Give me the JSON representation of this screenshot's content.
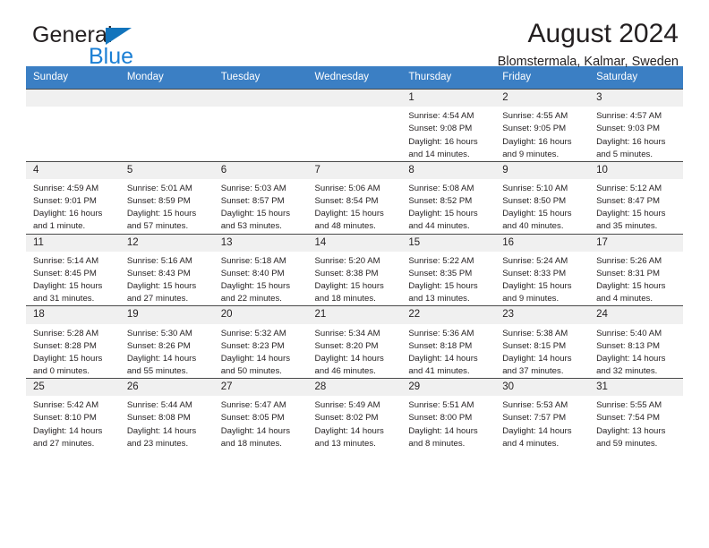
{
  "brand": {
    "name_top": "General",
    "name_bottom": "Blue",
    "triangle_color": "#1274bc",
    "blue_text_color": "#1b7fd4"
  },
  "header": {
    "title": "August 2024",
    "subtitle": "Blomstermala, Kalmar, Sweden",
    "header_bg_color": "#3b7fc4",
    "header_text_color": "#ffffff"
  },
  "calendar": {
    "weekday_headers": [
      "Sunday",
      "Monday",
      "Tuesday",
      "Wednesday",
      "Thursday",
      "Friday",
      "Saturday"
    ],
    "labels": {
      "sunrise": "Sunrise:",
      "sunset": "Sunset:",
      "daylight": "Daylight:"
    },
    "weeks": [
      [
        {
          "day": "",
          "empty": true
        },
        {
          "day": "",
          "empty": true
        },
        {
          "day": "",
          "empty": true
        },
        {
          "day": "",
          "empty": true
        },
        {
          "day": "1",
          "sunrise": "Sunrise: 4:54 AM",
          "sunset": "Sunset: 9:08 PM",
          "daylight_1": "Daylight: 16 hours",
          "daylight_2": "and 14 minutes."
        },
        {
          "day": "2",
          "sunrise": "Sunrise: 4:55 AM",
          "sunset": "Sunset: 9:05 PM",
          "daylight_1": "Daylight: 16 hours",
          "daylight_2": "and 9 minutes."
        },
        {
          "day": "3",
          "sunrise": "Sunrise: 4:57 AM",
          "sunset": "Sunset: 9:03 PM",
          "daylight_1": "Daylight: 16 hours",
          "daylight_2": "and 5 minutes."
        }
      ],
      [
        {
          "day": "4",
          "sunrise": "Sunrise: 4:59 AM",
          "sunset": "Sunset: 9:01 PM",
          "daylight_1": "Daylight: 16 hours",
          "daylight_2": "and 1 minute."
        },
        {
          "day": "5",
          "sunrise": "Sunrise: 5:01 AM",
          "sunset": "Sunset: 8:59 PM",
          "daylight_1": "Daylight: 15 hours",
          "daylight_2": "and 57 minutes."
        },
        {
          "day": "6",
          "sunrise": "Sunrise: 5:03 AM",
          "sunset": "Sunset: 8:57 PM",
          "daylight_1": "Daylight: 15 hours",
          "daylight_2": "and 53 minutes."
        },
        {
          "day": "7",
          "sunrise": "Sunrise: 5:06 AM",
          "sunset": "Sunset: 8:54 PM",
          "daylight_1": "Daylight: 15 hours",
          "daylight_2": "and 48 minutes."
        },
        {
          "day": "8",
          "sunrise": "Sunrise: 5:08 AM",
          "sunset": "Sunset: 8:52 PM",
          "daylight_1": "Daylight: 15 hours",
          "daylight_2": "and 44 minutes."
        },
        {
          "day": "9",
          "sunrise": "Sunrise: 5:10 AM",
          "sunset": "Sunset: 8:50 PM",
          "daylight_1": "Daylight: 15 hours",
          "daylight_2": "and 40 minutes."
        },
        {
          "day": "10",
          "sunrise": "Sunrise: 5:12 AM",
          "sunset": "Sunset: 8:47 PM",
          "daylight_1": "Daylight: 15 hours",
          "daylight_2": "and 35 minutes."
        }
      ],
      [
        {
          "day": "11",
          "sunrise": "Sunrise: 5:14 AM",
          "sunset": "Sunset: 8:45 PM",
          "daylight_1": "Daylight: 15 hours",
          "daylight_2": "and 31 minutes."
        },
        {
          "day": "12",
          "sunrise": "Sunrise: 5:16 AM",
          "sunset": "Sunset: 8:43 PM",
          "daylight_1": "Daylight: 15 hours",
          "daylight_2": "and 27 minutes."
        },
        {
          "day": "13",
          "sunrise": "Sunrise: 5:18 AM",
          "sunset": "Sunset: 8:40 PM",
          "daylight_1": "Daylight: 15 hours",
          "daylight_2": "and 22 minutes."
        },
        {
          "day": "14",
          "sunrise": "Sunrise: 5:20 AM",
          "sunset": "Sunset: 8:38 PM",
          "daylight_1": "Daylight: 15 hours",
          "daylight_2": "and 18 minutes."
        },
        {
          "day": "15",
          "sunrise": "Sunrise: 5:22 AM",
          "sunset": "Sunset: 8:35 PM",
          "daylight_1": "Daylight: 15 hours",
          "daylight_2": "and 13 minutes."
        },
        {
          "day": "16",
          "sunrise": "Sunrise: 5:24 AM",
          "sunset": "Sunset: 8:33 PM",
          "daylight_1": "Daylight: 15 hours",
          "daylight_2": "and 9 minutes."
        },
        {
          "day": "17",
          "sunrise": "Sunrise: 5:26 AM",
          "sunset": "Sunset: 8:31 PM",
          "daylight_1": "Daylight: 15 hours",
          "daylight_2": "and 4 minutes."
        }
      ],
      [
        {
          "day": "18",
          "sunrise": "Sunrise: 5:28 AM",
          "sunset": "Sunset: 8:28 PM",
          "daylight_1": "Daylight: 15 hours",
          "daylight_2": "and 0 minutes."
        },
        {
          "day": "19",
          "sunrise": "Sunrise: 5:30 AM",
          "sunset": "Sunset: 8:26 PM",
          "daylight_1": "Daylight: 14 hours",
          "daylight_2": "and 55 minutes."
        },
        {
          "day": "20",
          "sunrise": "Sunrise: 5:32 AM",
          "sunset": "Sunset: 8:23 PM",
          "daylight_1": "Daylight: 14 hours",
          "daylight_2": "and 50 minutes."
        },
        {
          "day": "21",
          "sunrise": "Sunrise: 5:34 AM",
          "sunset": "Sunset: 8:20 PM",
          "daylight_1": "Daylight: 14 hours",
          "daylight_2": "and 46 minutes."
        },
        {
          "day": "22",
          "sunrise": "Sunrise: 5:36 AM",
          "sunset": "Sunset: 8:18 PM",
          "daylight_1": "Daylight: 14 hours",
          "daylight_2": "and 41 minutes."
        },
        {
          "day": "23",
          "sunrise": "Sunrise: 5:38 AM",
          "sunset": "Sunset: 8:15 PM",
          "daylight_1": "Daylight: 14 hours",
          "daylight_2": "and 37 minutes."
        },
        {
          "day": "24",
          "sunrise": "Sunrise: 5:40 AM",
          "sunset": "Sunset: 8:13 PM",
          "daylight_1": "Daylight: 14 hours",
          "daylight_2": "and 32 minutes."
        }
      ],
      [
        {
          "day": "25",
          "sunrise": "Sunrise: 5:42 AM",
          "sunset": "Sunset: 8:10 PM",
          "daylight_1": "Daylight: 14 hours",
          "daylight_2": "and 27 minutes."
        },
        {
          "day": "26",
          "sunrise": "Sunrise: 5:44 AM",
          "sunset": "Sunset: 8:08 PM",
          "daylight_1": "Daylight: 14 hours",
          "daylight_2": "and 23 minutes."
        },
        {
          "day": "27",
          "sunrise": "Sunrise: 5:47 AM",
          "sunset": "Sunset: 8:05 PM",
          "daylight_1": "Daylight: 14 hours",
          "daylight_2": "and 18 minutes."
        },
        {
          "day": "28",
          "sunrise": "Sunrise: 5:49 AM",
          "sunset": "Sunset: 8:02 PM",
          "daylight_1": "Daylight: 14 hours",
          "daylight_2": "and 13 minutes."
        },
        {
          "day": "29",
          "sunrise": "Sunrise: 5:51 AM",
          "sunset": "Sunset: 8:00 PM",
          "daylight_1": "Daylight: 14 hours",
          "daylight_2": "and 8 minutes."
        },
        {
          "day": "30",
          "sunrise": "Sunrise: 5:53 AM",
          "sunset": "Sunset: 7:57 PM",
          "daylight_1": "Daylight: 14 hours",
          "daylight_2": "and 4 minutes."
        },
        {
          "day": "31",
          "sunrise": "Sunrise: 5:55 AM",
          "sunset": "Sunset: 7:54 PM",
          "daylight_1": "Daylight: 13 hours",
          "daylight_2": "and 59 minutes."
        }
      ]
    ]
  }
}
